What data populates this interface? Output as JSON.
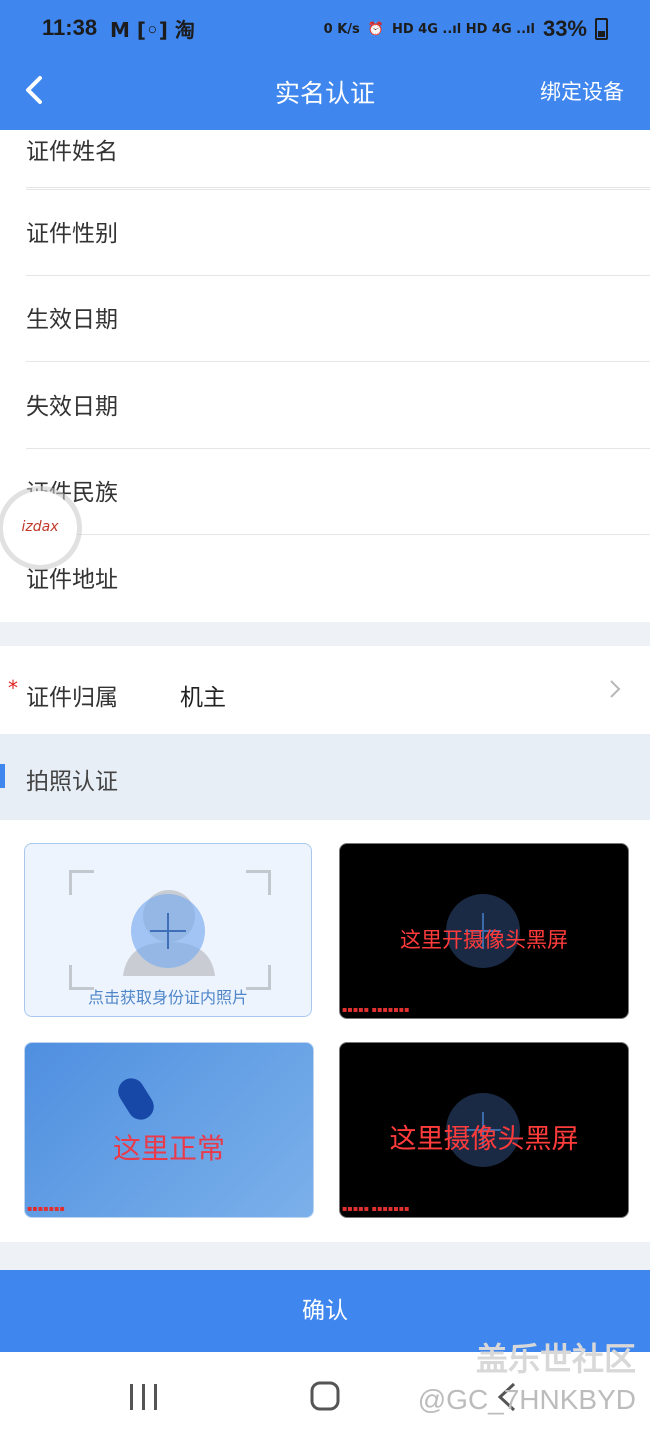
{
  "status_bar": {
    "time": "11:38",
    "left_icons": "M [◦] 淘",
    "net_speed": "0 K/s",
    "network": "HD 4G ..ıl HD 4G ..ıl",
    "battery": "33%"
  },
  "nav": {
    "title": "实名认证",
    "right_action": "绑定设备"
  },
  "fields": [
    {
      "label": "证件姓名"
    },
    {
      "label": "证件性别"
    },
    {
      "label": "生效日期"
    },
    {
      "label": "失效日期"
    },
    {
      "label": "证件民族"
    },
    {
      "label": "证件地址"
    }
  ],
  "ownership": {
    "required_mark": "*",
    "label": "证件归属",
    "value": "机主"
  },
  "photo_section": {
    "title": "拍照认证"
  },
  "photos": {
    "id_hint": "点击获取身份证内照片",
    "overlay_top_right": "这里开摄像头黑屏",
    "overlay_bottom_left": "这里正常",
    "overlay_bottom_right": "这里摄像头黑屏"
  },
  "confirm_button": "确认",
  "float_ball": "izdax",
  "watermark": {
    "line1": "盖乐世社区",
    "line2": "@GC_7HNKBYD"
  },
  "colors": {
    "primary": "#3f86ee",
    "required": "#e02424",
    "overlay_text": "#ff3b3b"
  }
}
